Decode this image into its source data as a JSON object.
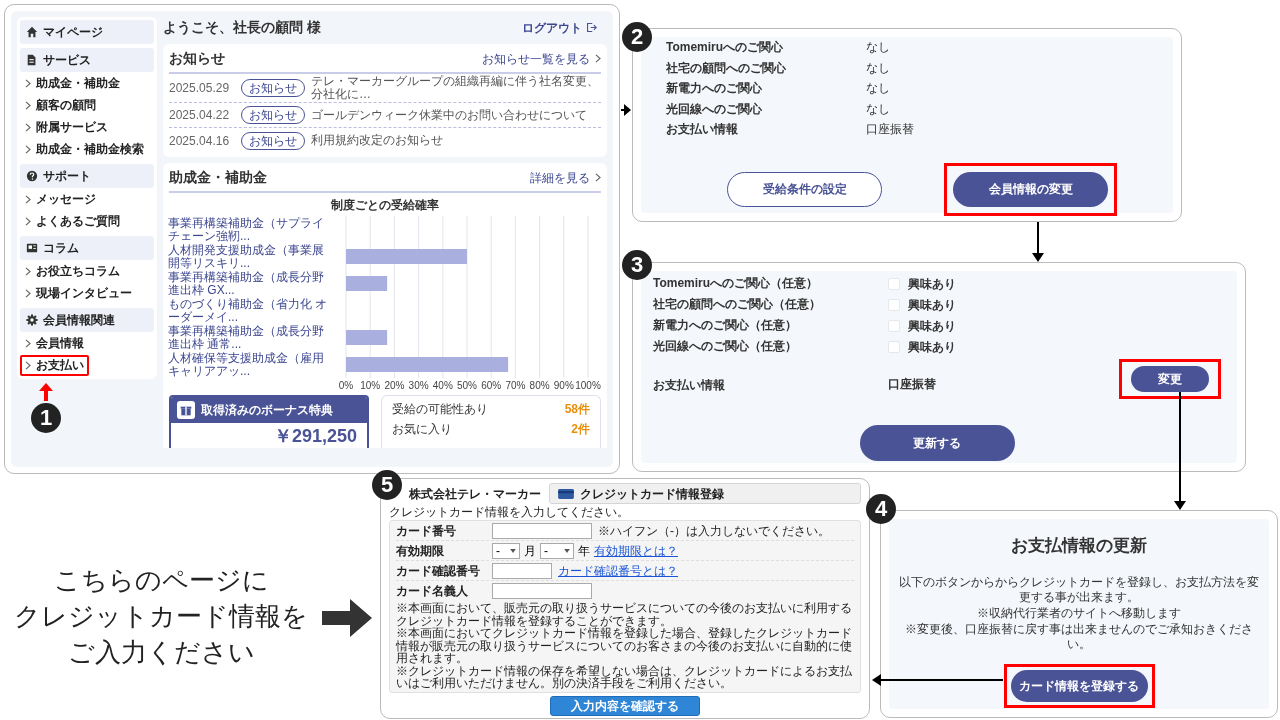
{
  "panel1": {
    "step": "1",
    "welcome": "ようこそ、社長の顧問 様",
    "logout": "ログアウト",
    "sidebar": [
      {
        "label": "マイページ"
      },
      {
        "label": "サービス",
        "items": [
          {
            "label": "助成金・補助金",
            "highlighted": false
          },
          {
            "label": "顧客の顧問",
            "highlighted": false
          },
          {
            "label": "附属サービス",
            "highlighted": false
          },
          {
            "label": "助成金・補助金検索",
            "highlighted": false
          }
        ]
      },
      {
        "label": "サポート",
        "items": [
          {
            "label": "メッセージ",
            "highlighted": false
          },
          {
            "label": "よくあるご質問",
            "highlighted": false
          }
        ]
      },
      {
        "label": "コラム",
        "items": [
          {
            "label": "お役立ちコラム",
            "highlighted": false
          },
          {
            "label": "現場インタビュー",
            "highlighted": false
          }
        ]
      },
      {
        "label": "会員情報関連",
        "items": [
          {
            "label": "会員情報",
            "highlighted": false
          },
          {
            "label": "お支払い",
            "highlighted": true
          }
        ]
      }
    ],
    "news": {
      "title": "お知らせ",
      "link": "お知らせ一覧を見る",
      "items": [
        {
          "date": "2025.05.29",
          "tag": "お知らせ",
          "text": "テレ・マーカーグループの組織再編に伴う社名変更、分社化に…"
        },
        {
          "date": "2025.04.22",
          "tag": "お知らせ",
          "text": "ゴールデンウィーク休業中のお問い合わせについて"
        },
        {
          "date": "2025.04.16",
          "tag": "お知らせ",
          "text": "利用規約改定のお知らせ"
        }
      ]
    },
    "grants": {
      "title": "助成金・補助金",
      "link": "詳細を見る",
      "chart_data": {
        "type": "bar",
        "orientation": "horizontal",
        "title": "制度ごとの受給確率",
        "grid": true,
        "categories": [
          "事業再構築補助金（サプライチェーン強靭...",
          "人材開発支援助成金（事業展開等リスキリ...",
          "事業再構築補助金（成長分野進出枠 GX...",
          "ものづくり補助金（省力化 オーダーメイ...",
          "事業再構築補助金（成長分野進出枠 通常...",
          "人材確保等支援助成金（雇用キャリアアッ..."
        ],
        "values": [
          0,
          50,
          17,
          0,
          17,
          67
        ],
        "xlim": [
          0,
          100
        ],
        "xticks": [
          {
            "value": 0,
            "label": "0%"
          },
          {
            "value": 10,
            "label": "10%"
          },
          {
            "value": 20,
            "label": "20%"
          },
          {
            "value": 30,
            "label": "30%"
          },
          {
            "value": 40,
            "label": "40%"
          },
          {
            "value": 50,
            "label": "50%"
          },
          {
            "value": 60,
            "label": "60%"
          },
          {
            "value": 70,
            "label": "70%"
          },
          {
            "value": 80,
            "label": "80%"
          },
          {
            "value": 90,
            "label": "90%"
          },
          {
            "value": 100,
            "label": "100%"
          }
        ]
      }
    },
    "bonus": {
      "title": "取得済みのボーナス特典",
      "amount": "￥291,250"
    },
    "stats": [
      {
        "label": "受給の可能性あり",
        "count": "58件"
      },
      {
        "label": "お気に入り",
        "count": "2件"
      }
    ]
  },
  "panel2": {
    "step": "2",
    "rows": [
      {
        "label": "Tomemiruへのご関心",
        "value": "なし"
      },
      {
        "label": "社宅の顧問へのご関心",
        "value": "なし"
      },
      {
        "label": "新電力へのご関心",
        "value": "なし"
      },
      {
        "label": "光回線へのご関心",
        "value": "なし"
      },
      {
        "label": "お支払い情報",
        "value": "口座振替"
      }
    ],
    "buttons": [
      {
        "label": "受給条件の設定",
        "kind": "outline",
        "highlighted": false
      },
      {
        "label": "会員情報の変更",
        "kind": "filled",
        "highlighted": true
      }
    ]
  },
  "panel3": {
    "step": "3",
    "rows": [
      {
        "kind": "checkbox",
        "label": "Tomemiruへのご関心（任意）",
        "option": "興味あり",
        "checked": false
      },
      {
        "kind": "checkbox",
        "label": "社宅の顧問へのご関心（任意）",
        "option": "興味あり",
        "checked": false
      },
      {
        "kind": "checkbox",
        "label": "新電力へのご関心（任意）",
        "option": "興味あり",
        "checked": false
      },
      {
        "kind": "checkbox",
        "label": "光回線へのご関心（任意）",
        "option": "興味あり",
        "checked": false
      },
      {
        "kind": "text",
        "label": "お支払い情報",
        "value": "口座振替"
      }
    ],
    "change_button": {
      "label": "変更",
      "highlighted": true
    },
    "submit_button": "更新する"
  },
  "panel4": {
    "step": "4",
    "title": "お支払情報の更新",
    "lines": [
      "以下のボタンからからクレジットカードを登録し、お支払方法を変更する事が出来ます。",
      "※収納代行業者のサイトへ移動します",
      "※変更後、口座振替に戻す事は出来ませんのでご承知おきください。"
    ],
    "button": {
      "label": "カード情報を登録する",
      "highlighted": true
    }
  },
  "panel5": {
    "step": "5",
    "company": "株式会社テレ・マーカー",
    "header": "クレジットカード情報登録",
    "intro": "クレジットカード情報を入力してください。",
    "fields": [
      {
        "kind": "text",
        "label": "カード番号",
        "note": "※ハイフン（-）は入力しないでください。"
      },
      {
        "kind": "expiry",
        "label": "有効期限",
        "month_value": "-",
        "month_unit": "月",
        "year_value": "-",
        "year_unit": "年",
        "link": "有効期限とは？"
      },
      {
        "kind": "short",
        "label": "カード確認番号",
        "link": "カード確認番号とは？"
      },
      {
        "kind": "text",
        "label": "カード名義人"
      }
    ],
    "notes": [
      "※本画面において、販売元の取り扱うサービスについての今後のお支払いに利用するクレジットカード情報を登録することができます。",
      "※本画面においてクレジットカード情報を登録した場合、登録したクレジットカード情報が販売元の取り扱うサービスについてのお客さまの今後のお支払いに自動的に使用されます。",
      "※クレジットカード情報の保存を希望しない場合は、クレジットカードによるお支払いはご利用いただけません。別の決済手段をご利用ください。"
    ],
    "button": "入力内容を確認する"
  },
  "caption": [
    "こちらのページに",
    "クレジットカード情報を",
    "ご入力ください"
  ]
}
